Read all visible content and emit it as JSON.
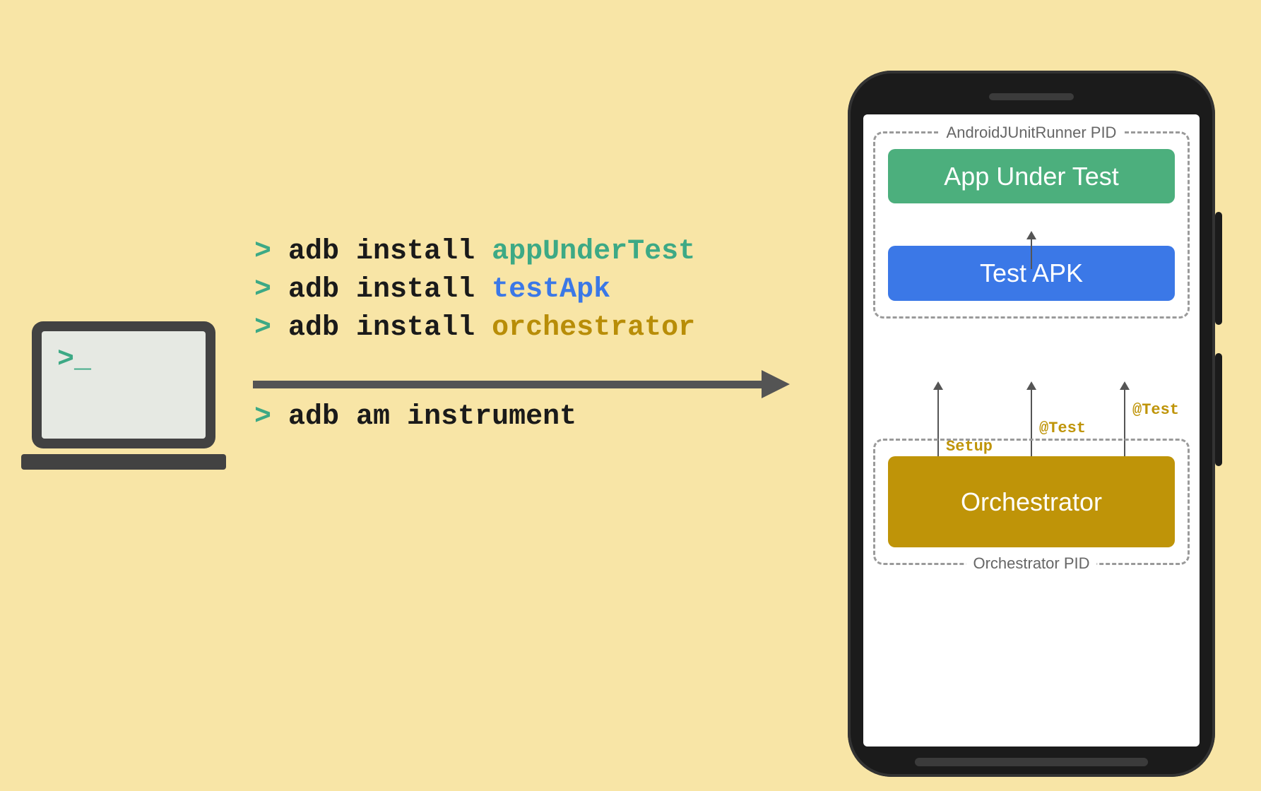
{
  "laptop": {
    "prompt": ">_"
  },
  "commands": {
    "prompt": ">",
    "install_prefix": "adb install",
    "instrument": "adb am instrument",
    "args": {
      "appUnderTest": "appUnderTest",
      "testApk": "testApk",
      "orchestrator": "orchestrator"
    }
  },
  "phone": {
    "junit_pid_label": "AndroidJUnitRunner PID",
    "orchestrator_pid_label": "Orchestrator PID",
    "tiles": {
      "app_under_test": "App Under Test",
      "test_apk": "Test APK",
      "orchestrator": "Orchestrator"
    },
    "arrow_labels": {
      "setup": "Setup",
      "test": "@Test"
    }
  }
}
